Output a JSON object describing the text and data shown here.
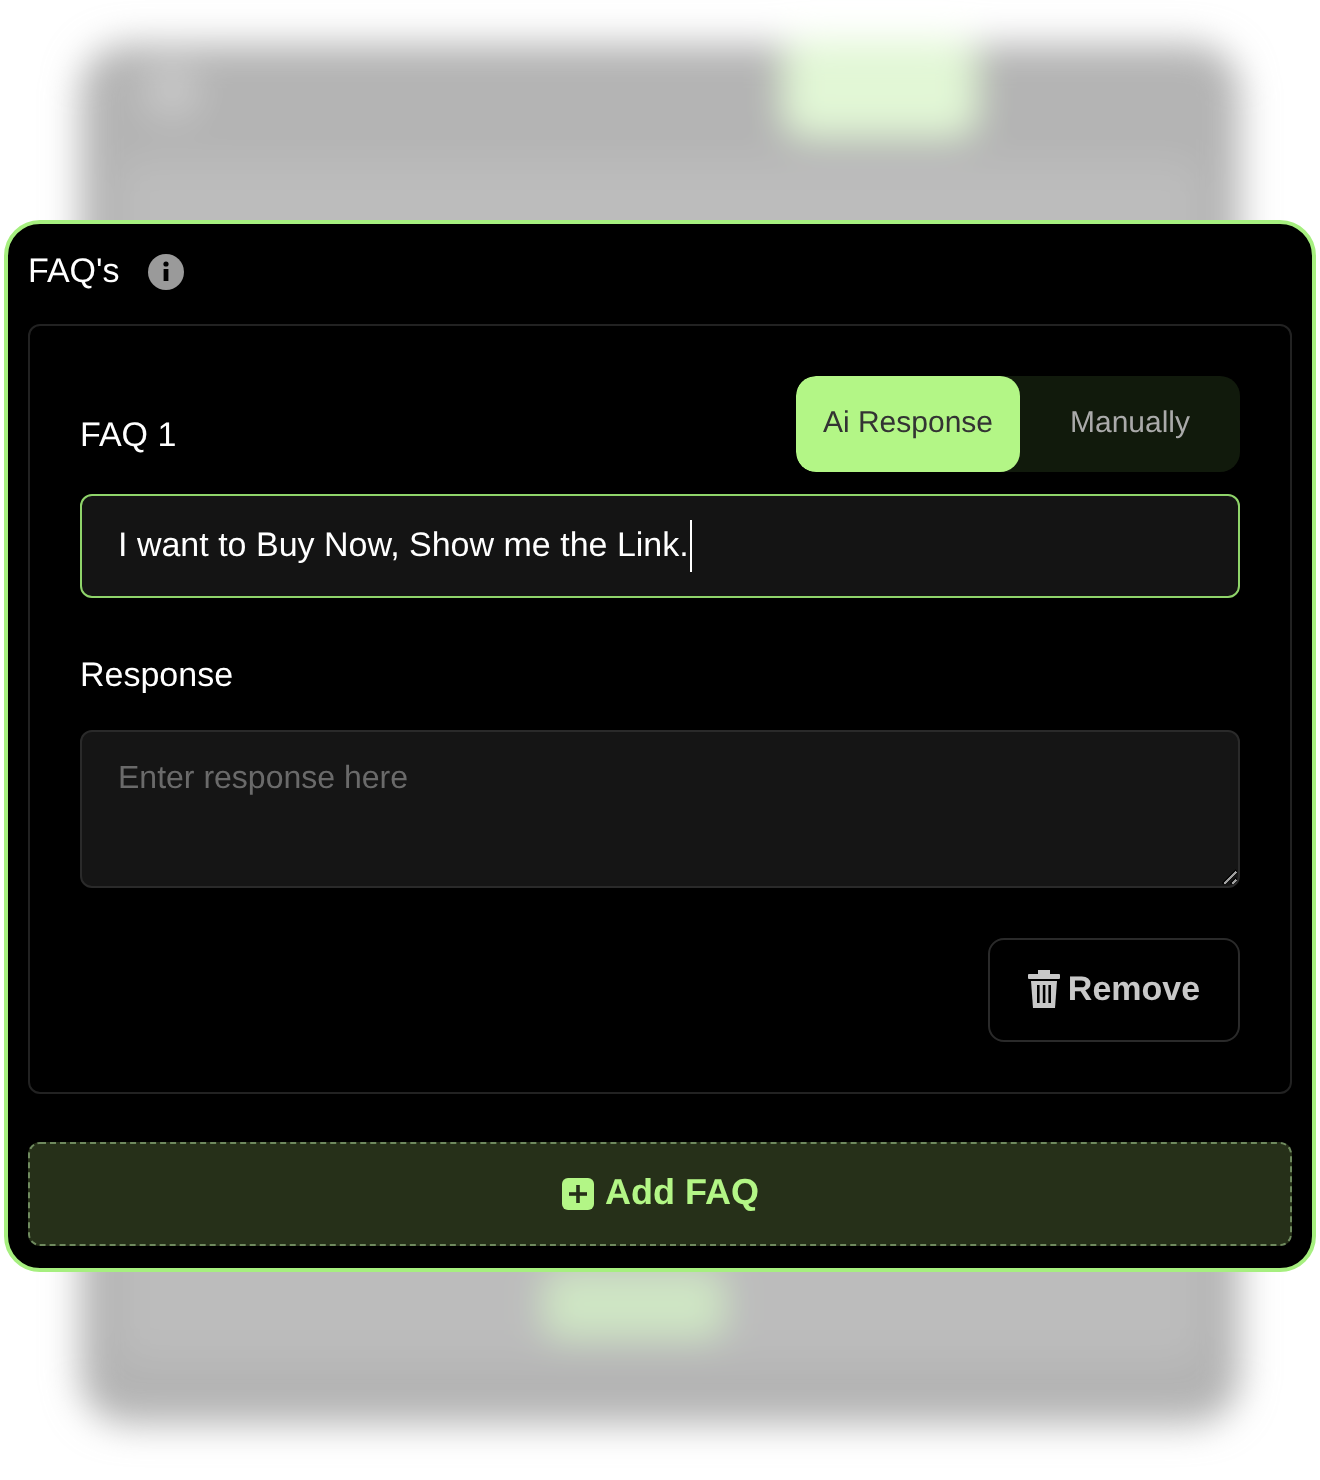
{
  "panel": {
    "title": "FAQ's"
  },
  "faqs": [
    {
      "label": "FAQ 1",
      "modes": [
        {
          "label": "Ai Response",
          "selected": true
        },
        {
          "label": "Manually",
          "selected": false
        }
      ],
      "question": "I want to Buy Now, Show me the Link.",
      "response_label": "Response",
      "response_placeholder": "Enter response here",
      "remove_button": "Remove"
    }
  ],
  "add_button": "Add FAQ"
}
